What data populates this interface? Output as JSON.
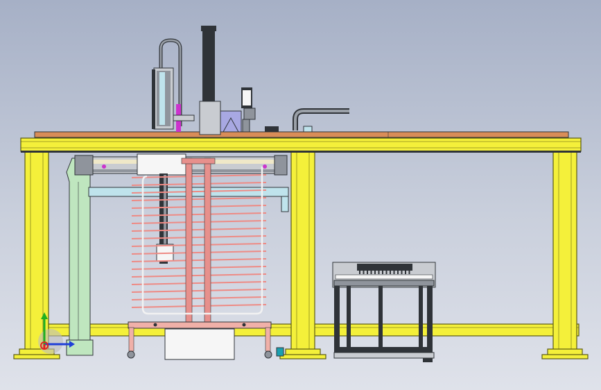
{
  "viewport": {
    "background_top": "#a6b0c6",
    "background_bottom": "#dfe2ea"
  },
  "colors": {
    "frame_yellow": "#f4f03a",
    "frame_edge": "#5b5a12",
    "plate_orange": "#d98d58",
    "rack_pink": "#e7908c",
    "rack_rod": "#ee8a84",
    "mint_green": "#bfe6bf",
    "light_blue": "#bfe3ec",
    "cart_pink": "#f0b0a8",
    "dark_steel": "#2f3338",
    "grey_part": "#8f949c",
    "lavender": "#a8a8e2",
    "magenta_accent": "#cc33cc"
  },
  "triad": {
    "x_axis_color": "#1f3fd8",
    "y_axis_color": "#20b020",
    "z_axis_color": "#e02020"
  },
  "icons": [
    "coordinate-triad-icon"
  ]
}
